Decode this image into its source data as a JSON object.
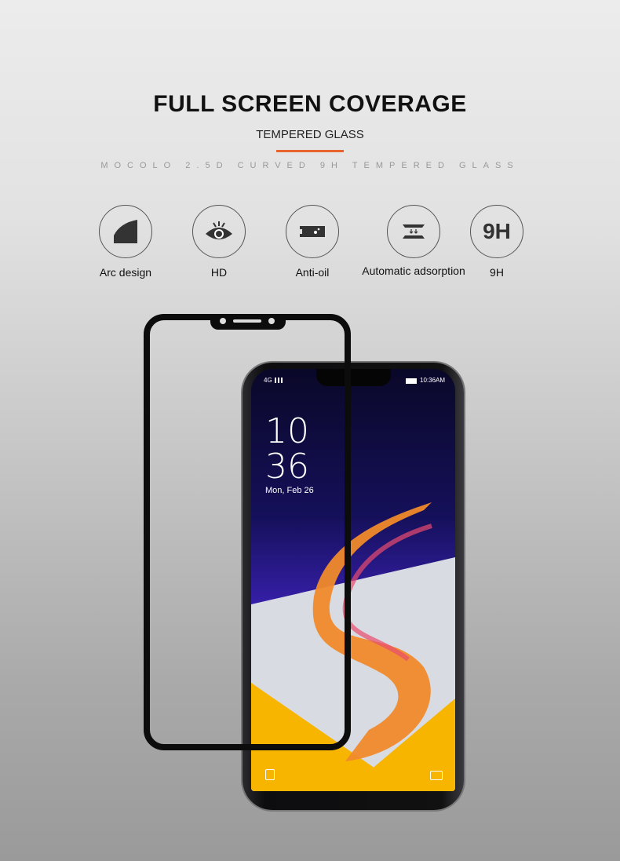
{
  "header": {
    "title": "FULL SCREEN COVERAGE",
    "subtitle": "TEMPERED GLASS",
    "tagline": "MOCOLO 2.5D CURVED 9H TEMPERED GLASS",
    "accent": "#e8642c"
  },
  "features": [
    {
      "icon": "arc-icon",
      "label": "Arc design"
    },
    {
      "icon": "eye-icon",
      "label": "HD"
    },
    {
      "icon": "oil-drop-icon",
      "label": "Anti-oil"
    },
    {
      "icon": "adsorption-icon",
      "label": "Automatic adsorption"
    },
    {
      "icon": "hardness-9h-icon",
      "icon_text": "9H",
      "label": "9H"
    }
  ],
  "phone": {
    "network": "4G",
    "status_time": "10:36AM",
    "clock_hour": "10",
    "clock_minute": "36",
    "date": "Mon, Feb 26"
  }
}
